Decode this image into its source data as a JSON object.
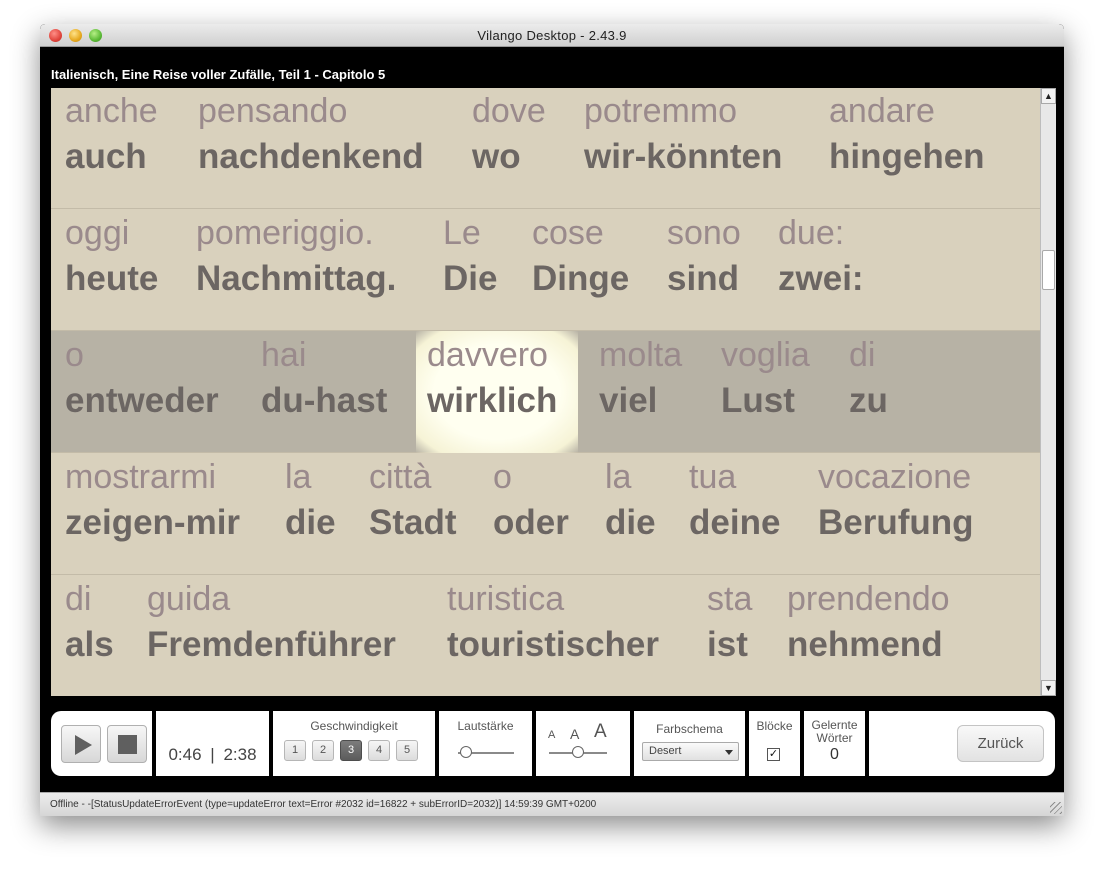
{
  "window": {
    "title": "Vilango Desktop - 2.43.9"
  },
  "lesson": {
    "title": "Italienisch, Eine Reise voller Zufälle, Teil 1 - Capitolo 5"
  },
  "rows": [
    {
      "words": [
        {
          "it": "anche",
          "de": "auch"
        },
        {
          "it": "pensando",
          "de": "nachdenkend"
        },
        {
          "it": "dove",
          "de": "wo"
        },
        {
          "it": "potremmo",
          "de": "wir-könnten"
        },
        {
          "it": "andare",
          "de": "hingehen"
        }
      ]
    },
    {
      "words": [
        {
          "it": "oggi",
          "de": "heute"
        },
        {
          "it": "pomeriggio.",
          "de": "Nachmittag."
        },
        {
          "it": "Le",
          "de": "Die"
        },
        {
          "it": "cose",
          "de": "Dinge"
        },
        {
          "it": "sono",
          "de": "sind"
        },
        {
          "it": "due:",
          "de": "zwei:"
        }
      ]
    },
    {
      "active": true,
      "words": [
        {
          "it": "o",
          "de": "entweder"
        },
        {
          "it": "hai",
          "de": "du-hast"
        },
        {
          "it": "davvero",
          "de": "wirklich",
          "highlight": true
        },
        {
          "it": "molta",
          "de": "viel"
        },
        {
          "it": "voglia",
          "de": "Lust"
        },
        {
          "it": "di",
          "de": "zu"
        }
      ]
    },
    {
      "words": [
        {
          "it": "mostrarmi",
          "de": "zeigen-mir"
        },
        {
          "it": "la",
          "de": "die"
        },
        {
          "it": "città",
          "de": "Stadt"
        },
        {
          "it": "o",
          "de": "oder"
        },
        {
          "it": "la",
          "de": "die"
        },
        {
          "it": "tua",
          "de": "deine"
        },
        {
          "it": "vocazione",
          "de": "Berufung"
        }
      ]
    },
    {
      "words": [
        {
          "it": "di",
          "de": "als"
        },
        {
          "it": "guida",
          "de": "Fremdenführer"
        },
        {
          "it": "turistica",
          "de": "touristischer"
        },
        {
          "it": "sta",
          "de": "ist"
        },
        {
          "it": "prendendo",
          "de": "nehmend"
        }
      ]
    }
  ],
  "controls": {
    "time_elapsed": "0:46",
    "time_separator": "|",
    "time_total": "2:38",
    "speed_label": "Geschwindigkeit",
    "speed_options": [
      "1",
      "2",
      "3",
      "4",
      "5"
    ],
    "speed_selected": "3",
    "volume_label": "Lautstärke",
    "volume_level": 0.15,
    "fontsize_small": "A",
    "fontsize_medium": "A",
    "fontsize_large": "A",
    "fontsize_level": 0.5,
    "colorscheme_label": "Farbschema",
    "colorscheme_value": "Desert",
    "blocks_label": "Blöcke",
    "blocks_checked": true,
    "learned_label_line1": "Gelernte",
    "learned_label_line2": "Wörter",
    "learned_count": "0",
    "back_label": "Zurück"
  },
  "status": {
    "text": "Offline - -[StatusUpdateErrorEvent (type=updateError text=Error #2032 id=16822 + subErrorID=2032)] 14:59:39 GMT+0200"
  },
  "colors": {
    "reader_bg": "#d9d1bd",
    "active_row_bg": "#b7b2a5",
    "italian_text": "#9a8a8c",
    "german_text": "#6c6663"
  }
}
